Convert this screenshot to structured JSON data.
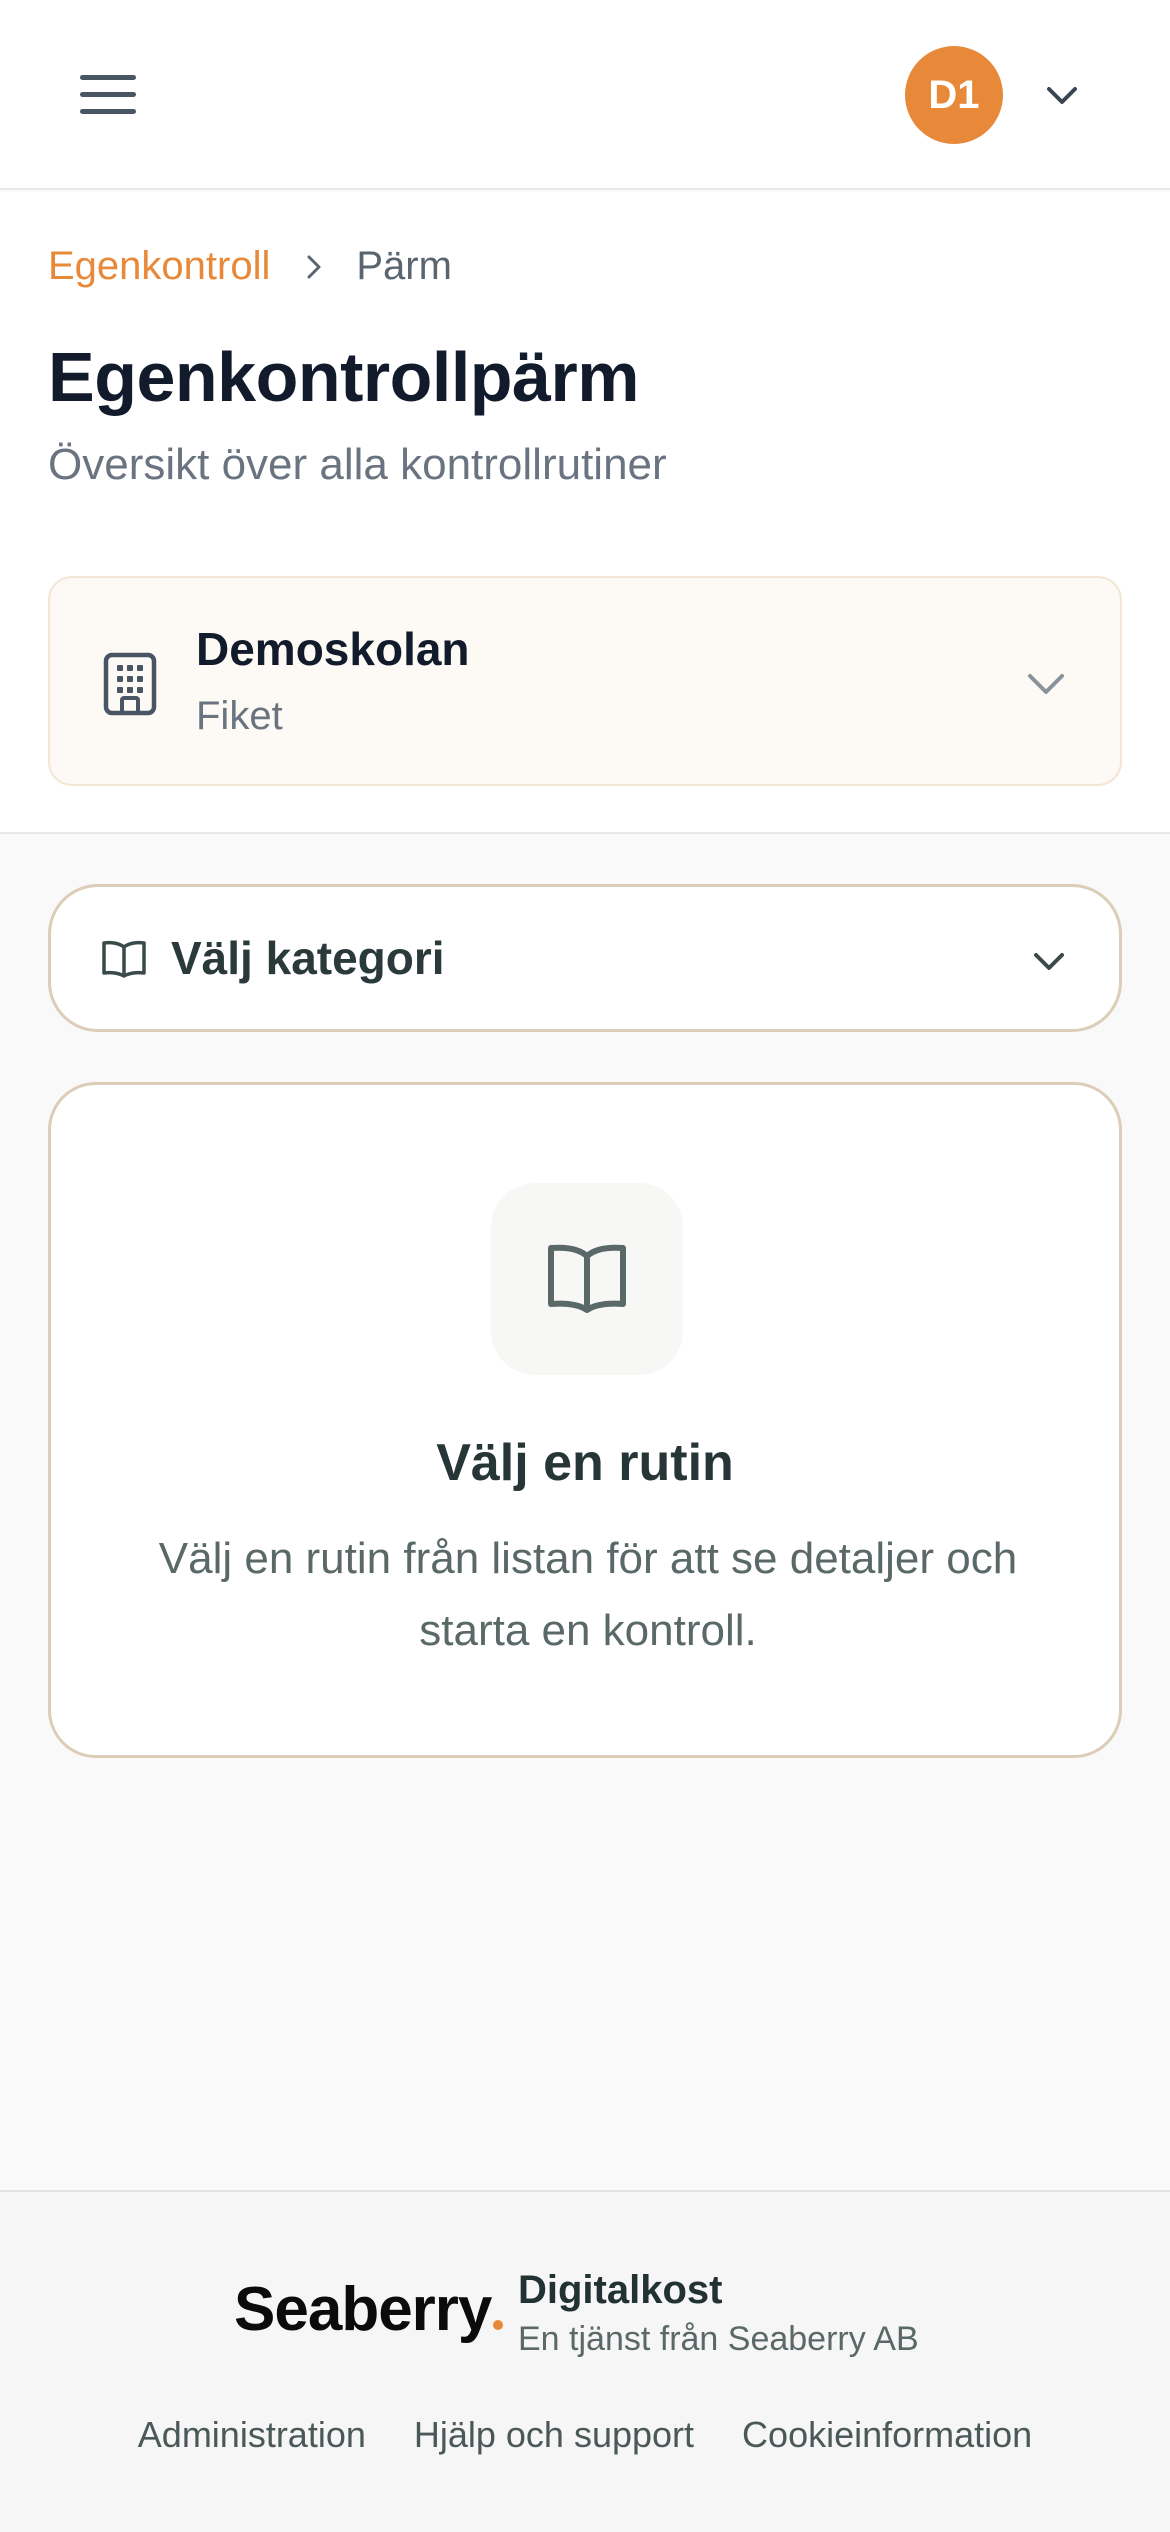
{
  "header": {
    "avatar_initials": "D1"
  },
  "breadcrumb": {
    "parent": "Egenkontroll",
    "current": "Pärm"
  },
  "page": {
    "title": "Egenkontrollpärm",
    "subtitle": "Översikt över alla kontrollrutiner"
  },
  "site_selector": {
    "name": "Demoskolan",
    "unit": "Fiket",
    "icon": "building-icon"
  },
  "category_select": {
    "label": "Välj kategori",
    "icon": "book-icon"
  },
  "empty_state": {
    "title": "Välj en rutin",
    "text": "Välj en rutin från listan för att se detaljer och starta en kontroll.",
    "icon": "book-open-icon"
  },
  "footer": {
    "logo_text": "Seaberry",
    "product_name": "Digitalkost",
    "tagline": "En tjänst från Seaberry AB",
    "links": [
      "Administration",
      "Hjälp och support",
      "Cookieinformation"
    ]
  },
  "colors": {
    "accent": "#e8893a",
    "card_border": "#dccdb8",
    "site_bg": "#fdf9f4"
  }
}
